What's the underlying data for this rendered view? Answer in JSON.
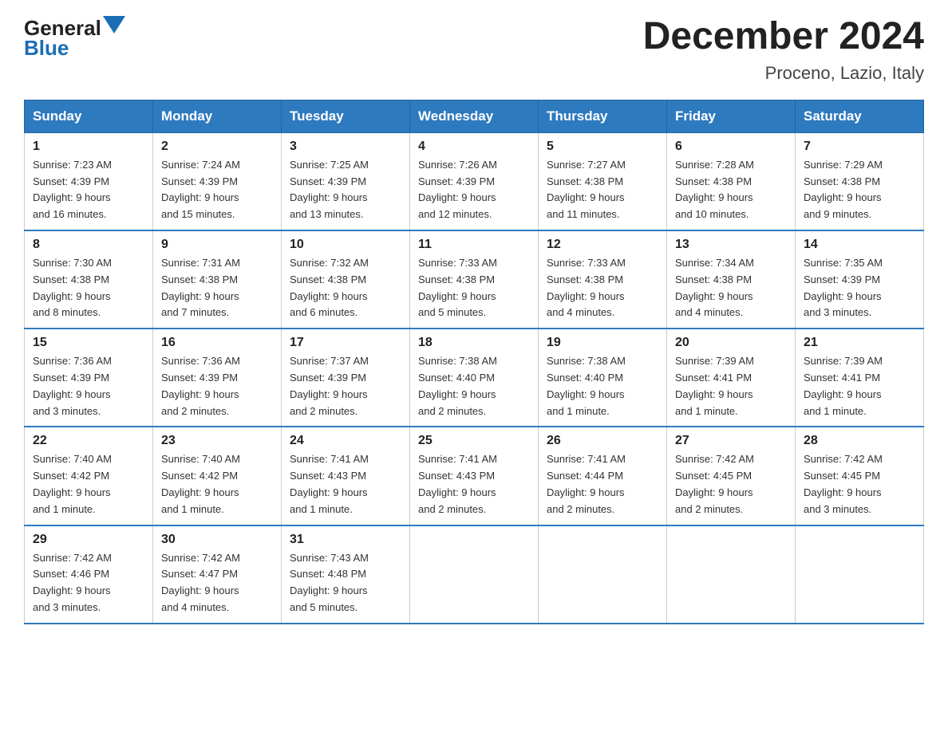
{
  "header": {
    "logo": {
      "general": "General",
      "blue": "Blue"
    },
    "title": "December 2024",
    "subtitle": "Proceno, Lazio, Italy"
  },
  "weekdays": [
    "Sunday",
    "Monday",
    "Tuesday",
    "Wednesday",
    "Thursday",
    "Friday",
    "Saturday"
  ],
  "weeks": [
    [
      {
        "day": "1",
        "sunrise": "7:23 AM",
        "sunset": "4:39 PM",
        "daylight": "9 hours and 16 minutes."
      },
      {
        "day": "2",
        "sunrise": "7:24 AM",
        "sunset": "4:39 PM",
        "daylight": "9 hours and 15 minutes."
      },
      {
        "day": "3",
        "sunrise": "7:25 AM",
        "sunset": "4:39 PM",
        "daylight": "9 hours and 13 minutes."
      },
      {
        "day": "4",
        "sunrise": "7:26 AM",
        "sunset": "4:39 PM",
        "daylight": "9 hours and 12 minutes."
      },
      {
        "day": "5",
        "sunrise": "7:27 AM",
        "sunset": "4:38 PM",
        "daylight": "9 hours and 11 minutes."
      },
      {
        "day": "6",
        "sunrise": "7:28 AM",
        "sunset": "4:38 PM",
        "daylight": "9 hours and 10 minutes."
      },
      {
        "day": "7",
        "sunrise": "7:29 AM",
        "sunset": "4:38 PM",
        "daylight": "9 hours and 9 minutes."
      }
    ],
    [
      {
        "day": "8",
        "sunrise": "7:30 AM",
        "sunset": "4:38 PM",
        "daylight": "9 hours and 8 minutes."
      },
      {
        "day": "9",
        "sunrise": "7:31 AM",
        "sunset": "4:38 PM",
        "daylight": "9 hours and 7 minutes."
      },
      {
        "day": "10",
        "sunrise": "7:32 AM",
        "sunset": "4:38 PM",
        "daylight": "9 hours and 6 minutes."
      },
      {
        "day": "11",
        "sunrise": "7:33 AM",
        "sunset": "4:38 PM",
        "daylight": "9 hours and 5 minutes."
      },
      {
        "day": "12",
        "sunrise": "7:33 AM",
        "sunset": "4:38 PM",
        "daylight": "9 hours and 4 minutes."
      },
      {
        "day": "13",
        "sunrise": "7:34 AM",
        "sunset": "4:38 PM",
        "daylight": "9 hours and 4 minutes."
      },
      {
        "day": "14",
        "sunrise": "7:35 AM",
        "sunset": "4:39 PM",
        "daylight": "9 hours and 3 minutes."
      }
    ],
    [
      {
        "day": "15",
        "sunrise": "7:36 AM",
        "sunset": "4:39 PM",
        "daylight": "9 hours and 3 minutes."
      },
      {
        "day": "16",
        "sunrise": "7:36 AM",
        "sunset": "4:39 PM",
        "daylight": "9 hours and 2 minutes."
      },
      {
        "day": "17",
        "sunrise": "7:37 AM",
        "sunset": "4:39 PM",
        "daylight": "9 hours and 2 minutes."
      },
      {
        "day": "18",
        "sunrise": "7:38 AM",
        "sunset": "4:40 PM",
        "daylight": "9 hours and 2 minutes."
      },
      {
        "day": "19",
        "sunrise": "7:38 AM",
        "sunset": "4:40 PM",
        "daylight": "9 hours and 1 minute."
      },
      {
        "day": "20",
        "sunrise": "7:39 AM",
        "sunset": "4:41 PM",
        "daylight": "9 hours and 1 minute."
      },
      {
        "day": "21",
        "sunrise": "7:39 AM",
        "sunset": "4:41 PM",
        "daylight": "9 hours and 1 minute."
      }
    ],
    [
      {
        "day": "22",
        "sunrise": "7:40 AM",
        "sunset": "4:42 PM",
        "daylight": "9 hours and 1 minute."
      },
      {
        "day": "23",
        "sunrise": "7:40 AM",
        "sunset": "4:42 PM",
        "daylight": "9 hours and 1 minute."
      },
      {
        "day": "24",
        "sunrise": "7:41 AM",
        "sunset": "4:43 PM",
        "daylight": "9 hours and 1 minute."
      },
      {
        "day": "25",
        "sunrise": "7:41 AM",
        "sunset": "4:43 PM",
        "daylight": "9 hours and 2 minutes."
      },
      {
        "day": "26",
        "sunrise": "7:41 AM",
        "sunset": "4:44 PM",
        "daylight": "9 hours and 2 minutes."
      },
      {
        "day": "27",
        "sunrise": "7:42 AM",
        "sunset": "4:45 PM",
        "daylight": "9 hours and 2 minutes."
      },
      {
        "day": "28",
        "sunrise": "7:42 AM",
        "sunset": "4:45 PM",
        "daylight": "9 hours and 3 minutes."
      }
    ],
    [
      {
        "day": "29",
        "sunrise": "7:42 AM",
        "sunset": "4:46 PM",
        "daylight": "9 hours and 3 minutes."
      },
      {
        "day": "30",
        "sunrise": "7:42 AM",
        "sunset": "4:47 PM",
        "daylight": "9 hours and 4 minutes."
      },
      {
        "day": "31",
        "sunrise": "7:43 AM",
        "sunset": "4:48 PM",
        "daylight": "9 hours and 5 minutes."
      },
      null,
      null,
      null,
      null
    ]
  ]
}
